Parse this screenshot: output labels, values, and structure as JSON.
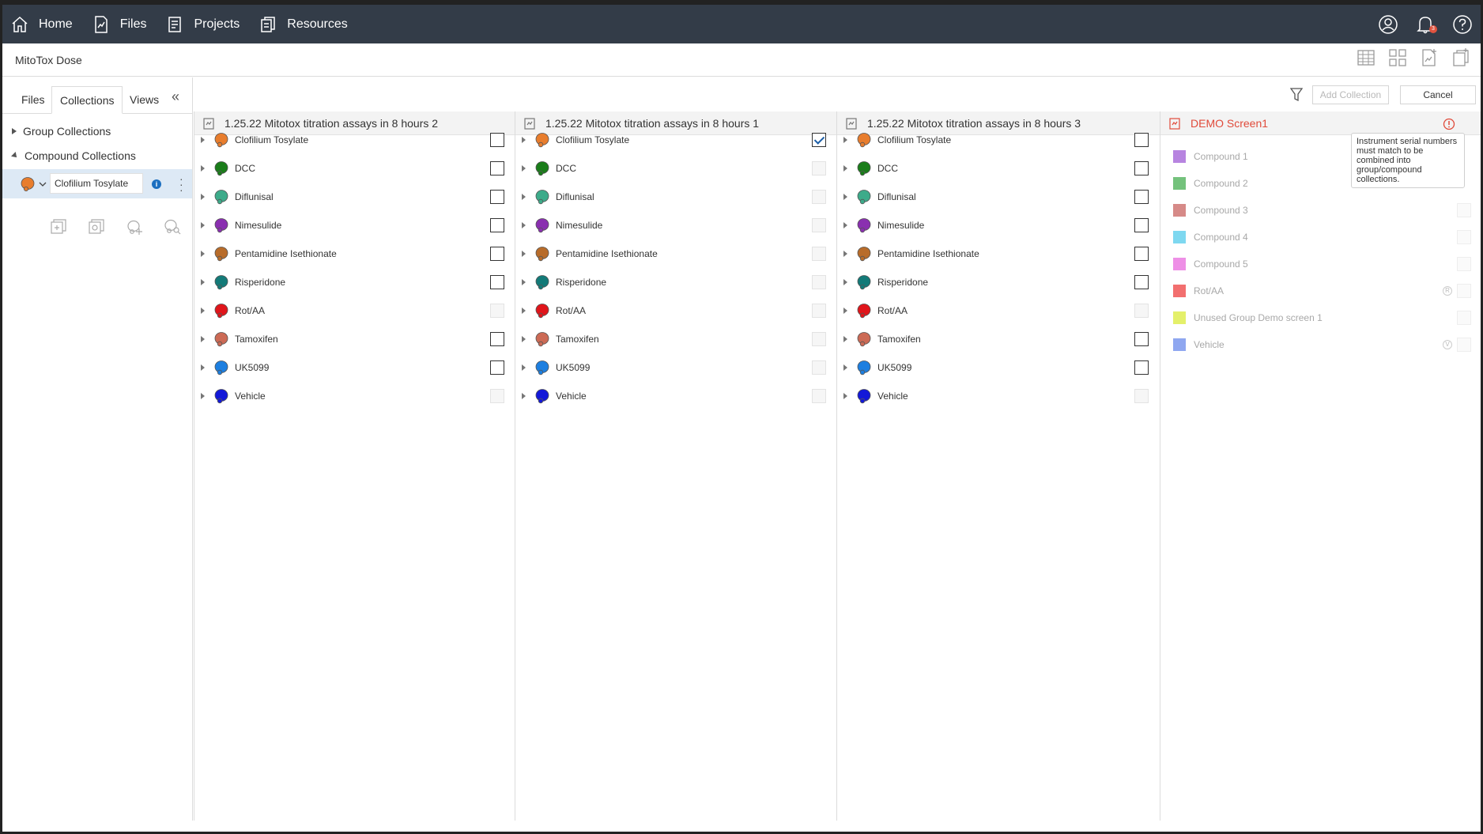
{
  "nav": {
    "items": [
      {
        "label": "Home",
        "icon": "home-icon"
      },
      {
        "label": "Files",
        "icon": "files-chart-icon"
      },
      {
        "label": "Projects",
        "icon": "projects-icon"
      },
      {
        "label": "Resources",
        "icon": "resources-icon"
      }
    ],
    "notification_count": "3"
  },
  "page": {
    "title": "MitoTox Dose"
  },
  "sidebar": {
    "tabs": [
      "Files",
      "Collections",
      "Views"
    ],
    "active_tab": "Collections",
    "tree": [
      "Group Collections",
      "Compound Collections"
    ],
    "selected_collection": "Clofilium Tosylate",
    "info_label": "i"
  },
  "toolbar": {
    "add_label": "Add Collection",
    "cancel_label": "Cancel"
  },
  "columns": [
    {
      "title": "1.25.22 Mitotox titration assays in 8 hours 2",
      "rows": [
        {
          "name": "Clofilium Tosylate",
          "color": "#e87d2d",
          "state": "empty"
        },
        {
          "name": "DCC",
          "color": "#1a7d1a",
          "state": "empty"
        },
        {
          "name": "Diflunisal",
          "color": "#3dab8a",
          "state": "empty"
        },
        {
          "name": "Nimesulide",
          "color": "#8a2fb0",
          "state": "empty"
        },
        {
          "name": "Pentamidine Isethionate",
          "color": "#b86c2a",
          "state": "empty"
        },
        {
          "name": "Risperidone",
          "color": "#137a78",
          "state": "empty"
        },
        {
          "name": "Rot/AA",
          "color": "#e0151b",
          "state": "disabled"
        },
        {
          "name": "Tamoxifen",
          "color": "#cc6a55",
          "state": "empty"
        },
        {
          "name": "UK5099",
          "color": "#1d7fe0",
          "state": "empty"
        },
        {
          "name": "Vehicle",
          "color": "#1318d8",
          "state": "disabled"
        }
      ]
    },
    {
      "title": "1.25.22 Mitotox titration assays in 8 hours 1",
      "rows": [
        {
          "name": "Clofilium Tosylate",
          "color": "#e87d2d",
          "state": "checked"
        },
        {
          "name": "DCC",
          "color": "#1a7d1a",
          "state": "disabled"
        },
        {
          "name": "Diflunisal",
          "color": "#3dab8a",
          "state": "disabled"
        },
        {
          "name": "Nimesulide",
          "color": "#8a2fb0",
          "state": "disabled"
        },
        {
          "name": "Pentamidine Isethionate",
          "color": "#b86c2a",
          "state": "disabled"
        },
        {
          "name": "Risperidone",
          "color": "#137a78",
          "state": "disabled"
        },
        {
          "name": "Rot/AA",
          "color": "#e0151b",
          "state": "disabled"
        },
        {
          "name": "Tamoxifen",
          "color": "#cc6a55",
          "state": "disabled"
        },
        {
          "name": "UK5099",
          "color": "#1d7fe0",
          "state": "disabled"
        },
        {
          "name": "Vehicle",
          "color": "#1318d8",
          "state": "disabled"
        }
      ]
    },
    {
      "title": "1.25.22 Mitotox titration assays in 8 hours 3",
      "rows": [
        {
          "name": "Clofilium Tosylate",
          "color": "#e87d2d",
          "state": "empty"
        },
        {
          "name": "DCC",
          "color": "#1a7d1a",
          "state": "empty"
        },
        {
          "name": "Diflunisal",
          "color": "#3dab8a",
          "state": "empty"
        },
        {
          "name": "Nimesulide",
          "color": "#8a2fb0",
          "state": "empty"
        },
        {
          "name": "Pentamidine Isethionate",
          "color": "#b86c2a",
          "state": "empty"
        },
        {
          "name": "Risperidone",
          "color": "#137a78",
          "state": "empty"
        },
        {
          "name": "Rot/AA",
          "color": "#e0151b",
          "state": "disabled"
        },
        {
          "name": "Tamoxifen",
          "color": "#cc6a55",
          "state": "empty"
        },
        {
          "name": "UK5099",
          "color": "#1d7fe0",
          "state": "empty"
        },
        {
          "name": "Vehicle",
          "color": "#1318d8",
          "state": "disabled"
        }
      ]
    }
  ],
  "demo": {
    "title": "DEMO Screen1",
    "tooltip": "Instrument serial numbers must match to be combined into group/compound collections.",
    "rows": [
      {
        "name": "Compound 1",
        "color": "#b784e0",
        "mini": ""
      },
      {
        "name": "Compound 2",
        "color": "#74c27c",
        "mini": ""
      },
      {
        "name": "Compound 3",
        "color": "#d68a88",
        "mini": ""
      },
      {
        "name": "Compound 4",
        "color": "#7ed8f0",
        "mini": ""
      },
      {
        "name": "Compound 5",
        "color": "#ee8fe6",
        "mini": ""
      },
      {
        "name": "Rot/AA",
        "color": "#f26f6f",
        "mini": "R"
      },
      {
        "name": "Unused Group Demo screen 1",
        "color": "#e4f06a",
        "mini": ""
      },
      {
        "name": "Vehicle",
        "color": "#8fa7f0",
        "mini": "V"
      }
    ]
  }
}
